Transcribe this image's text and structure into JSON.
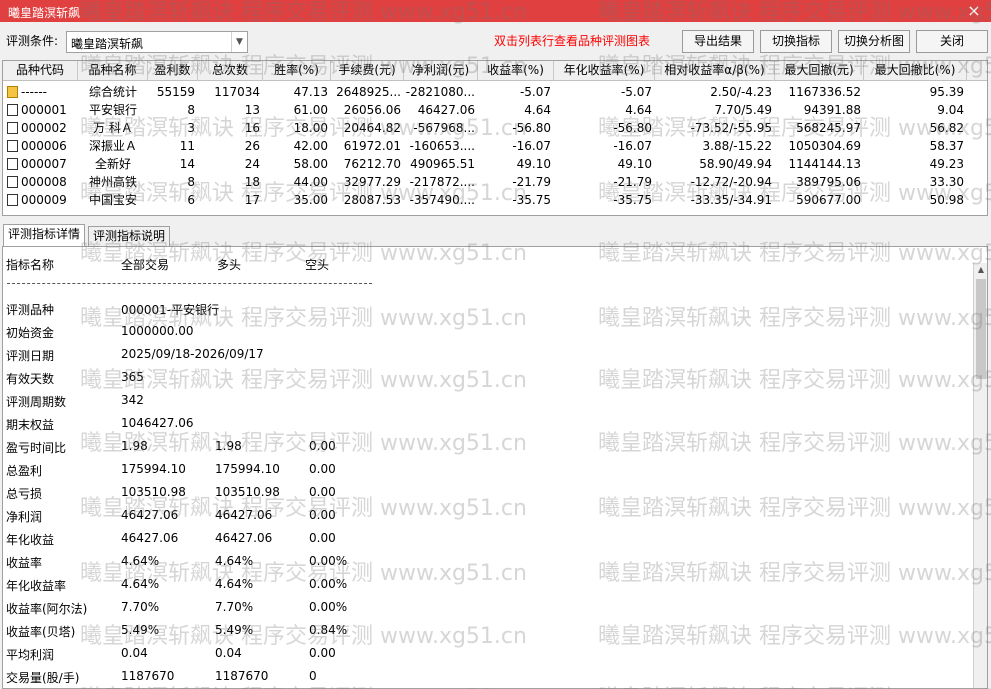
{
  "window": {
    "title": "曦皇踏溟斩飙",
    "close_glyph": "×"
  },
  "toolbar": {
    "condition_label": "评测条件:",
    "condition_value": "曦皇踏溟斩飙",
    "hint": "双击列表行查看品种评测图表",
    "buttons": {
      "export": "导出结果",
      "switch_indicator": "切换指标",
      "switch_chart": "切换分析图",
      "close": "关闭"
    }
  },
  "table": {
    "columns": [
      "品种代码",
      "品种名称",
      "盈利数",
      "总次数",
      "胜率(%)",
      "手续费(元)",
      "净利润(元)",
      "收益率(%)",
      "年化收益率(%)",
      "相对收益率α/β(%)",
      "最大回撤(元)",
      "最大回撤比(%)"
    ],
    "rows": [
      {
        "code": "------",
        "name": "综合统计",
        "wins": "55159",
        "total": "117034",
        "win_rate": "47.13",
        "fee": "2648925...",
        "net_profit": "-2821080...",
        "return": "-5.07",
        "annual": "-5.07",
        "relative": "2.50/-4.23",
        "max_dd": "1167336.52",
        "max_dd_pct": "95.39"
      },
      {
        "code": "000001",
        "name": "平安银行",
        "wins": "8",
        "total": "13",
        "win_rate": "61.00",
        "fee": "26056.06",
        "net_profit": "46427.06",
        "return": "4.64",
        "annual": "4.64",
        "relative": "7.70/5.49",
        "max_dd": "94391.88",
        "max_dd_pct": "9.04"
      },
      {
        "code": "000002",
        "name": "万 科Ａ",
        "wins": "3",
        "total": "16",
        "win_rate": "18.00",
        "fee": "20464.82",
        "net_profit": "-567968...",
        "return": "-56.80",
        "annual": "-56.80",
        "relative": "-73.52/-55.95",
        "max_dd": "568245.97",
        "max_dd_pct": "56.82"
      },
      {
        "code": "000006",
        "name": "深振业Ａ",
        "wins": "11",
        "total": "26",
        "win_rate": "42.00",
        "fee": "61972.01",
        "net_profit": "-160653....",
        "return": "-16.07",
        "annual": "-16.07",
        "relative": "3.88/-15.22",
        "max_dd": "1050304.69",
        "max_dd_pct": "58.37"
      },
      {
        "code": "000007",
        "name": "全新好",
        "wins": "14",
        "total": "24",
        "win_rate": "58.00",
        "fee": "76212.70",
        "net_profit": "490965.51",
        "return": "49.10",
        "annual": "49.10",
        "relative": "58.90/49.94",
        "max_dd": "1144144.13",
        "max_dd_pct": "49.23"
      },
      {
        "code": "000008",
        "name": "神州高铁",
        "wins": "8",
        "total": "18",
        "win_rate": "44.00",
        "fee": "32977.29",
        "net_profit": "-217872....",
        "return": "-21.79",
        "annual": "-21.79",
        "relative": "-12.72/-20.94",
        "max_dd": "389795.06",
        "max_dd_pct": "33.30"
      },
      {
        "code": "000009",
        "name": "中国宝安",
        "wins": "6",
        "total": "17",
        "win_rate": "35.00",
        "fee": "28087.53",
        "net_profit": "-357490....",
        "return": "-35.75",
        "annual": "-35.75",
        "relative": "-33.35/-34.91",
        "max_dd": "590677.00",
        "max_dd_pct": "50.98"
      }
    ]
  },
  "tabs": {
    "detail": "评测指标详情",
    "explain": "评测指标说明"
  },
  "detail": {
    "header": {
      "name": "指标名称",
      "all": "全部交易",
      "long": "多头",
      "short": "空头"
    },
    "separator": "------------------------------------------------------------------------",
    "info": [
      {
        "label": "评测品种",
        "value": "000001-平安银行"
      },
      {
        "label": "初始资金",
        "value": "1000000.00"
      },
      {
        "label": "评测日期",
        "value": "2025/09/18-2026/09/17"
      },
      {
        "label": "有效天数",
        "value": "365"
      },
      {
        "label": "评测周期数",
        "value": "342"
      },
      {
        "label": "期末权益",
        "value": "1046427.06"
      }
    ],
    "metrics": [
      {
        "label": "盈亏时间比",
        "all": "1.98",
        "long": "1.98",
        "short": "0.00"
      },
      {
        "label": "总盈利",
        "all": "175994.10",
        "long": "175994.10",
        "short": "0.00"
      },
      {
        "label": "总亏损",
        "all": "103510.98",
        "long": "103510.98",
        "short": "0.00"
      },
      {
        "label": "净利润",
        "all": "46427.06",
        "long": "46427.06",
        "short": "0.00"
      },
      {
        "label": "年化收益",
        "all": "46427.06",
        "long": "46427.06",
        "short": "0.00"
      },
      {
        "label": "收益率",
        "all": "4.64%",
        "long": "4.64%",
        "short": "0.00%"
      },
      {
        "label": "年化收益率",
        "all": "4.64%",
        "long": "4.64%",
        "short": "0.00%"
      },
      {
        "label": "收益率(阿尔法)",
        "all": "7.70%",
        "long": "7.70%",
        "short": "0.00%"
      },
      {
        "label": "收益率(贝塔)",
        "all": "5.49%",
        "long": "5.49%",
        "short": "0.84%"
      },
      {
        "label": "平均利润",
        "all": "0.04",
        "long": "0.04",
        "short": "0.00"
      },
      {
        "label": "交易量(股/手)",
        "all": "1187670",
        "long": "1187670",
        "short": "0"
      }
    ]
  },
  "watermarks": {
    "text_long": "曦皇踏溟斩飙诀 程序交易评测 www.xg51.cn",
    "text_short": "曦皇踏溟斩飙诀 程序交易评测 www.xg5"
  }
}
